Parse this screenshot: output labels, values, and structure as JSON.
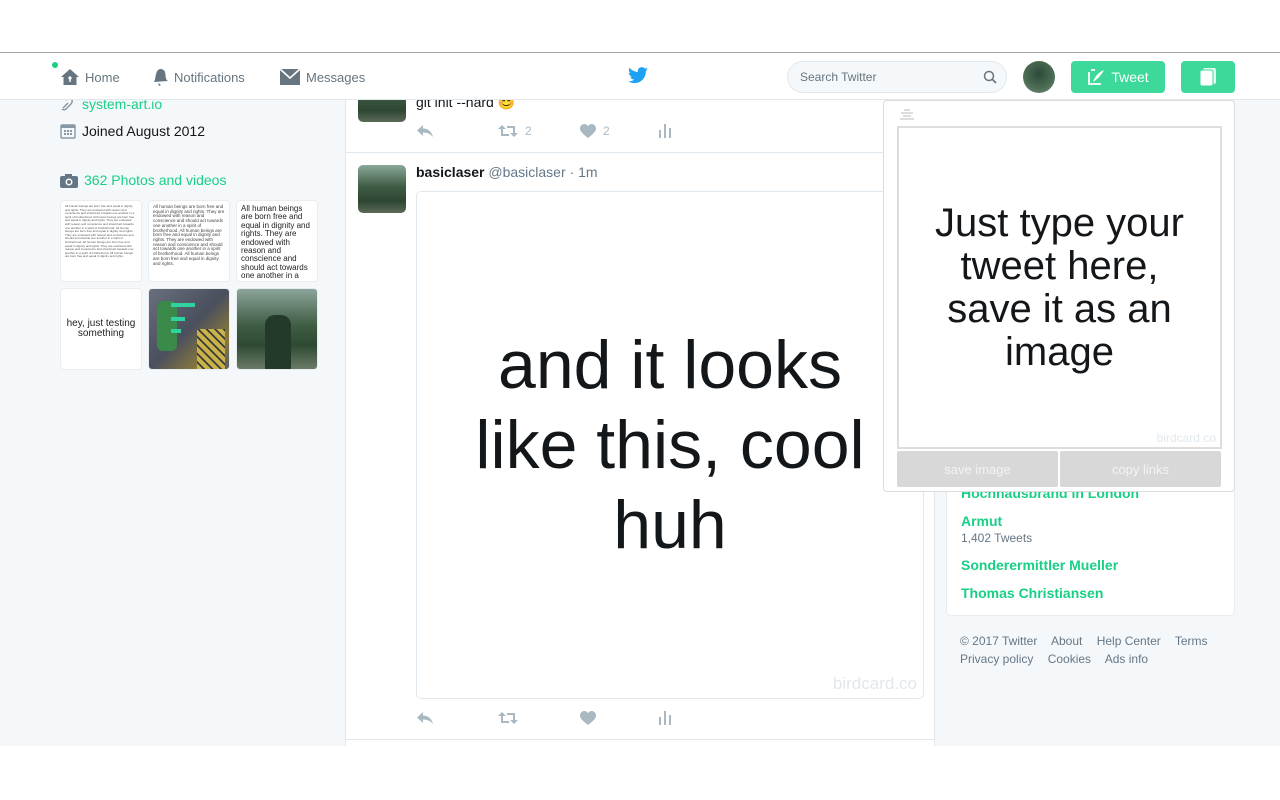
{
  "nav": {
    "home": "Home",
    "notifications": "Notifications",
    "messages": "Messages",
    "search_placeholder": "Search Twitter",
    "tweet_button": "Tweet"
  },
  "profile": {
    "website": "system-art.io",
    "joined": "Joined August 2012",
    "photos_link": "362 Photos and videos",
    "thumbs": [
      {
        "text": "All human beings are born free and equal in dignity and rights. They are endowed with reason and conscience and should act towards one another in a spirit of brotherhood. All human beings are born free and equal in dignity and rights. They are endowed with reason and conscience and should act towards one another in a spirit of brotherhood. All human beings are born free and equal in dignity and rights. They are endowed with reason and conscience and should act towards one another in a spirit of brotherhood. All human beings are born free and equal in dignity and rights. They are endowed with reason and conscience and should act towards one another in a spirit of brotherhood. All human beings are born free and equal in dignity and rights."
      },
      {
        "text": "All human beings are born free and equal in dignity and rights. They are endowed with reason and conscience and should act towards one another in a spirit of brotherhood. All human beings are born free and equal in dignity and rights. They are endowed with reason and conscience and should act towards one another in a spirit of brotherhood. All human beings are born free and equal in dignity and rights."
      },
      {
        "text": "All human beings are born free and equal in dignity and rights. They are endowed with reason and conscience and should act towards one another in a spirit of brotherhood."
      },
      {
        "text": "hey, just testing something"
      }
    ]
  },
  "timeline": {
    "tweet1": {
      "text": "git init --hard 😊",
      "retweets": "2",
      "likes": "2"
    },
    "tweet2": {
      "name": "basiclaser",
      "handle": "@basiclaser",
      "time": "· 1m",
      "card_text": "and it looks like this, cool huh",
      "watermark": "birdcard.co"
    }
  },
  "trends": [
    {
      "name": "Hochhausbrand in London",
      "sub": ""
    },
    {
      "name": "Armut",
      "sub": "1,402 Tweets"
    },
    {
      "name": "Sonderermittler Mueller",
      "sub": ""
    },
    {
      "name": "Thomas Christiansen",
      "sub": ""
    }
  ],
  "footer": {
    "line1": [
      "© 2017 Twitter",
      "About",
      "Help Center",
      "Terms"
    ],
    "line2": [
      "Privacy policy",
      "Cookies",
      "Ads info"
    ]
  },
  "popup": {
    "text": "Just type your tweet here, save it as an image",
    "watermark": "birdcard.co",
    "save_button": "save image",
    "copy_button": "copy links"
  },
  "colors": {
    "accent": "#19cf86",
    "button": "#3cd99a",
    "twitter_blue": "#1da1f2"
  }
}
